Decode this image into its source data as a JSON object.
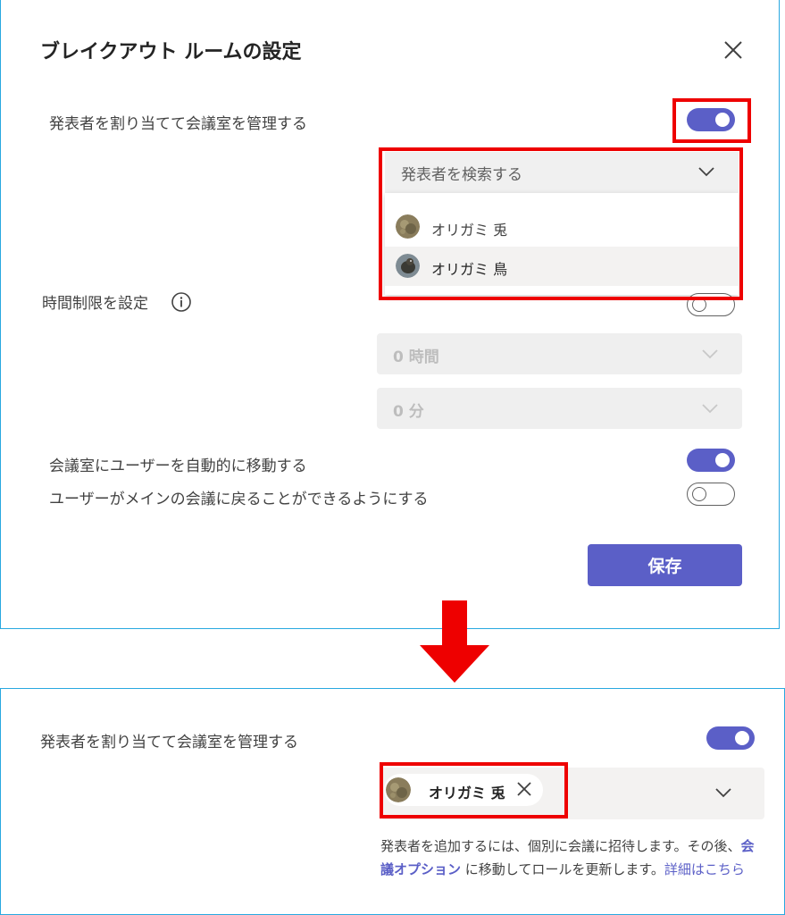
{
  "dialog": {
    "title": "ブレイクアウト ルームの設定",
    "assign_presenters_label": "発表者を割り当てて会議室を管理する",
    "presenter_search": {
      "placeholder": "発表者を検索する",
      "options": [
        {
          "name": "オリガミ 兎",
          "avatar_icon": "rabbit-avatar"
        },
        {
          "name": "オリガミ 鳥",
          "avatar_icon": "bird-avatar"
        }
      ]
    },
    "time_limit_label": "時間制限を設定",
    "hours_value": "0 時間",
    "minutes_value": "0 分",
    "auto_move_label": "会議室にユーザーを自動的に移動する",
    "return_label": "ユーザーがメインの会議に戻ることができるようにする",
    "save_label": "保存",
    "toggles": {
      "assign_presenters": true,
      "time_limit": false,
      "auto_move": true,
      "return_to_main": false
    }
  },
  "after": {
    "assign_presenters_label": "発表者を割り当てて会議室を管理する",
    "selected_presenter": "オリガミ 兎",
    "help_text_1": "発表者を追加するには、個別に会議に招待します。その後、",
    "help_link_1": "会議オプション",
    "help_text_2": " に移動してロールを更新します。",
    "help_link_2": "詳細はこちら"
  },
  "colors": {
    "accent": "#5b5fc7",
    "highlight": "#ee0000",
    "frame": "#29a8e0"
  }
}
